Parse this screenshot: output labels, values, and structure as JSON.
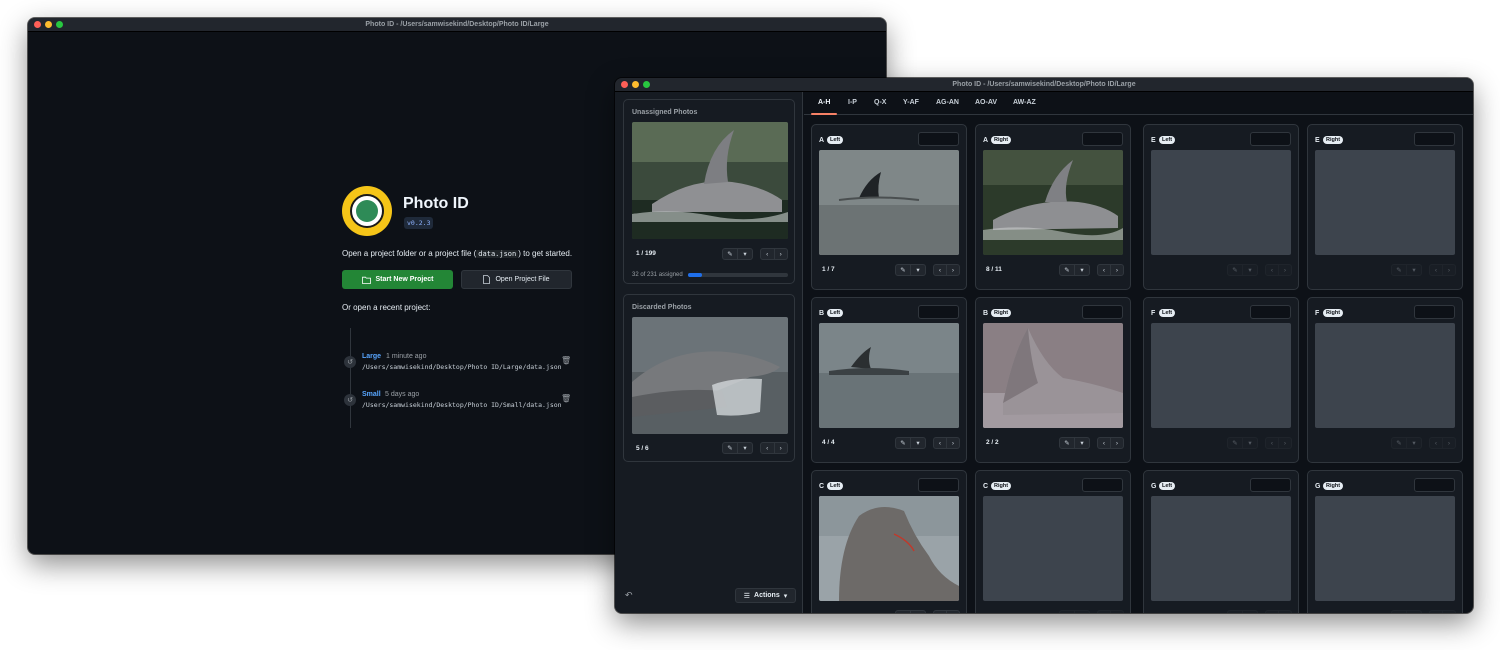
{
  "back_window": {
    "title": "Photo ID - /Users/samwisekind/Desktop/Photo ID/Large",
    "app_name": "Photo ID",
    "version": "v0.2.3",
    "intro_prefix": "Open a project folder or a project file (",
    "intro_code": "data.json",
    "intro_suffix": ") to get started.",
    "start_button": "Start New Project",
    "open_button": "Open Project File",
    "recent_heading": "Or open a recent project:",
    "recent": [
      {
        "name": "Large",
        "time": "1 minute ago",
        "path": "/Users/samwisekind/Desktop/Photo ID/Large/data.json"
      },
      {
        "name": "Small",
        "time": "5 days ago",
        "path": "/Users/samwisekind/Desktop/Photo ID/Small/data.json"
      }
    ]
  },
  "front_window": {
    "title": "Photo ID - /Users/samwisekind/Desktop/Photo ID/Large",
    "unassigned": {
      "title": "Unassigned Photos",
      "counter": "1 / 199",
      "assigned_text": "32 of 231 assigned",
      "progress": 0.14
    },
    "discarded": {
      "title": "Discarded Photos",
      "counter": "5 / 6"
    },
    "actions_label": "Actions",
    "tabs": [
      "A-H",
      "I-P",
      "Q-X",
      "Y-AF",
      "AG-AN",
      "AO-AV",
      "AW-AZ"
    ],
    "active_tab": "A-H",
    "cards": [
      {
        "letter": "A",
        "side": "Left",
        "count": "1 / 7"
      },
      {
        "letter": "A",
        "side": "Right",
        "count": "8 / 11"
      },
      {
        "letter": "E",
        "side": "Left",
        "count": ""
      },
      {
        "letter": "E",
        "side": "Right",
        "count": ""
      },
      {
        "letter": "B",
        "side": "Left",
        "count": "4 / 4"
      },
      {
        "letter": "B",
        "side": "Right",
        "count": "2 / 2"
      },
      {
        "letter": "F",
        "side": "Left",
        "count": ""
      },
      {
        "letter": "F",
        "side": "Right",
        "count": ""
      },
      {
        "letter": "C",
        "side": "Left",
        "count": ""
      },
      {
        "letter": "C",
        "side": "Right",
        "count": ""
      },
      {
        "letter": "G",
        "side": "Left",
        "count": ""
      },
      {
        "letter": "G",
        "side": "Right",
        "count": ""
      }
    ]
  }
}
